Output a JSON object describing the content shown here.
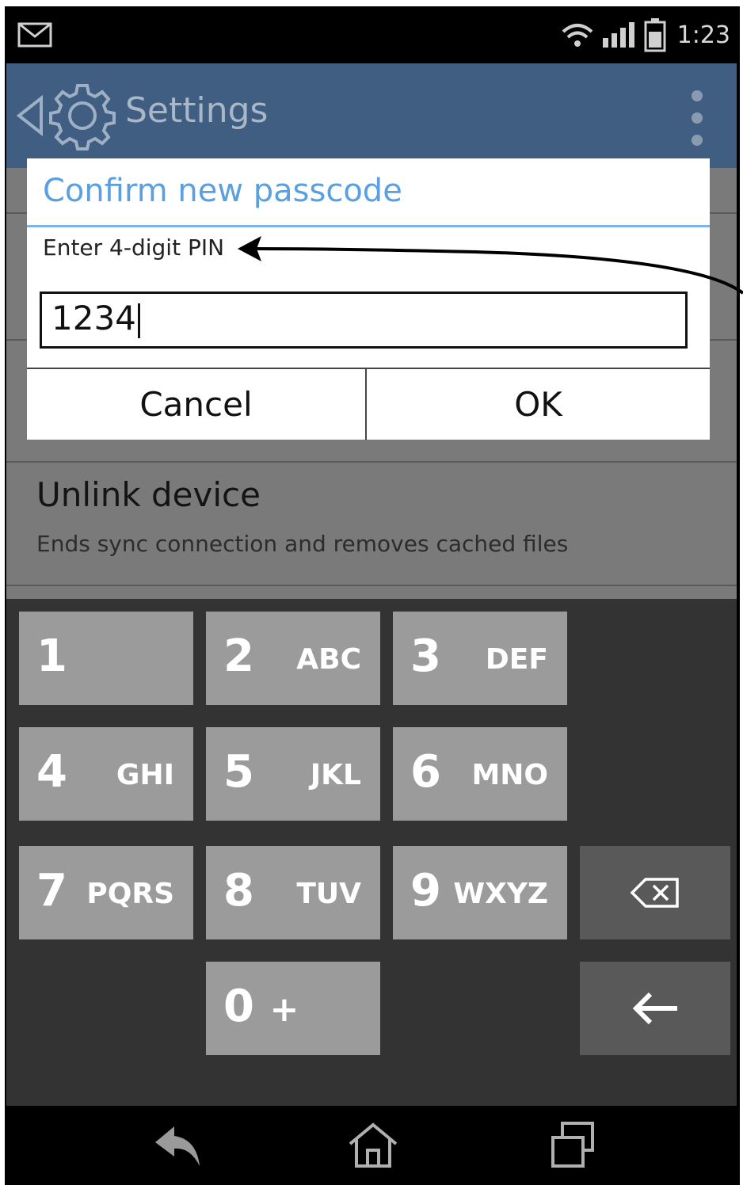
{
  "status_bar": {
    "time": "1:23",
    "icons": [
      "mail-icon",
      "wifi-icon",
      "signal-icon",
      "battery-icon"
    ]
  },
  "action_bar": {
    "title": "Settings",
    "icons": [
      "back-caret-icon",
      "gear-icon",
      "overflow-menu-icon"
    ],
    "color": "#3f5e82"
  },
  "dialog": {
    "title": "Confirm new passcode",
    "label": "Enter 4-digit PIN",
    "pin_value": "1234",
    "cancel_label": "Cancel",
    "ok_label": "OK",
    "title_color": "#5aa0e0"
  },
  "settings": {
    "unlink_title": "Unlink device",
    "unlink_subtitle": "Ends sync connection and removes cached files"
  },
  "keypad": {
    "keys": [
      {
        "digit": "1",
        "letters": ""
      },
      {
        "digit": "2",
        "letters": "ABC"
      },
      {
        "digit": "3",
        "letters": "DEF"
      },
      {
        "digit": "4",
        "letters": "GHI"
      },
      {
        "digit": "5",
        "letters": "JKL"
      },
      {
        "digit": "6",
        "letters": "MNO"
      },
      {
        "digit": "7",
        "letters": "PQRS"
      },
      {
        "digit": "8",
        "letters": "TUV"
      },
      {
        "digit": "9",
        "letters": "WXYZ"
      },
      {
        "digit": "0",
        "letters": "+"
      }
    ],
    "special_keys": [
      "backspace-icon",
      "enter-arrow-icon"
    ]
  },
  "nav_bar": {
    "icons": [
      "back-icon",
      "home-icon",
      "recent-apps-icon"
    ]
  }
}
